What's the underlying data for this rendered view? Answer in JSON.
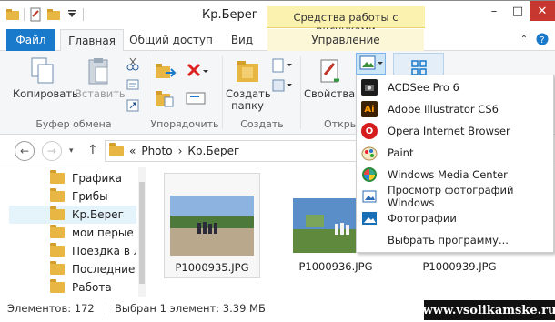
{
  "window": {
    "title": "Кр.Берег",
    "context_header": "Средства работы с рисунками",
    "minimize": "–",
    "maximize": "□",
    "close": "✕"
  },
  "tabs": {
    "file": "Файл",
    "home": "Главная",
    "share": "Общий доступ",
    "view": "Вид",
    "manage": "Управление"
  },
  "ribbon": {
    "copy": "Копировать",
    "paste": "Вставить",
    "clipboard_group": "Буфер обмена",
    "organize_group": "Упорядочить",
    "new_folder": "Создать папку",
    "create_group": "Создать",
    "properties": "Свойства",
    "open_group": "Откры"
  },
  "address": {
    "prefix": "«",
    "segment1": "Photo",
    "sep": "›",
    "segment2": "Кр.Берег"
  },
  "sidebar": {
    "items": [
      {
        "label": "Графика"
      },
      {
        "label": "Грибы"
      },
      {
        "label": "Кр.Берег"
      },
      {
        "label": "мои перые"
      },
      {
        "label": "Поездка в ле"
      },
      {
        "label": "Последние с"
      },
      {
        "label": "Работа"
      }
    ]
  },
  "files": [
    {
      "name": "P1000935.JPG"
    },
    {
      "name": "P1000936.JPG"
    },
    {
      "name": "P1000939.JPG"
    }
  ],
  "status": {
    "count": "Элементов: 172",
    "selected": "Выбран 1 элемент: 3.39 МБ"
  },
  "open_with_menu": {
    "items": [
      {
        "label": "ACDSee Pro 6",
        "icon": "acdsee-icon"
      },
      {
        "label": "Adobe Illustrator CS6",
        "icon": "illustrator-icon",
        "glyph": "Ai"
      },
      {
        "label": "Opera Internet Browser",
        "icon": "opera-icon",
        "glyph": "O"
      },
      {
        "label": "Paint",
        "icon": "paint-icon"
      },
      {
        "label": "Windows Media Center",
        "icon": "media-center-icon"
      },
      {
        "label": "Просмотр фотографий Windows",
        "icon": "photo-viewer-icon"
      },
      {
        "label": "Фотографии",
        "icon": "photos-icon"
      },
      {
        "label": "Выбрать программу...",
        "icon": ""
      }
    ]
  },
  "watermark": "www.vsolikamske.ru",
  "colors": {
    "accent": "#1979ca",
    "context_tab": "#fcf2b0",
    "folder": "#e7b643"
  }
}
